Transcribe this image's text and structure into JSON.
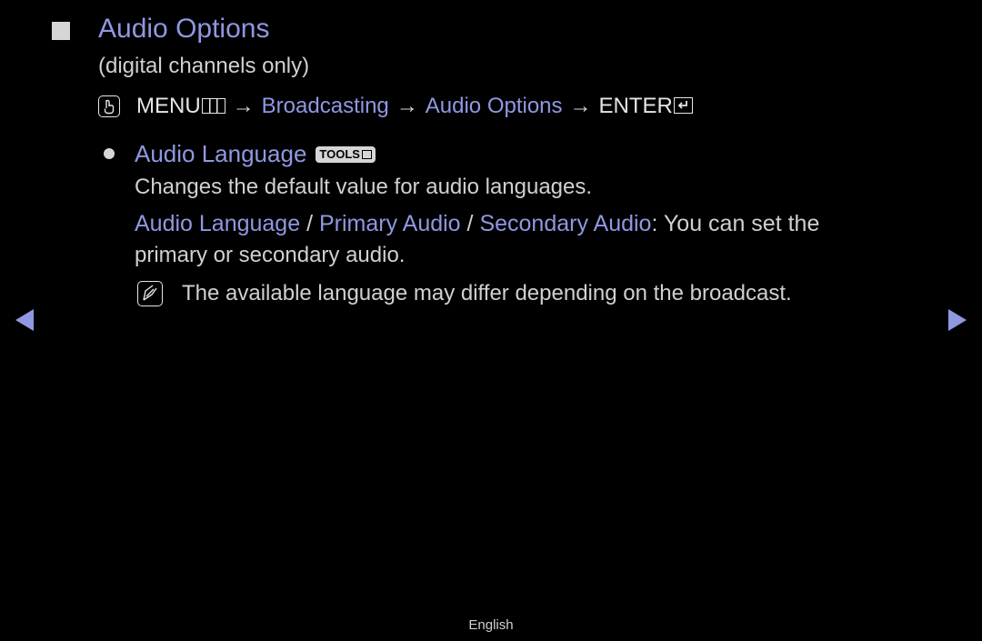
{
  "header": {
    "title": "Audio Options",
    "subtitle": "(digital channels only)"
  },
  "menu_path": {
    "icon": "hand-pointer-icon",
    "menu_label": "MENU",
    "arrow": "→",
    "steps": [
      "Broadcasting",
      "Audio Options"
    ],
    "enter_label": "ENTER"
  },
  "section": {
    "heading": "Audio Language",
    "tools_badge": "TOOLS",
    "description": "Changes the default value for audio languages.",
    "options": [
      "Audio Language",
      "Primary Audio",
      "Secondary Audio"
    ],
    "separator": " / ",
    "options_suffix": ": You can set the",
    "options_line2": "primary or secondary audio.",
    "note": "The available language may differ depending on the broadcast."
  },
  "navigation": {
    "prev": "previous-page",
    "next": "next-page"
  },
  "footer": {
    "language": "English"
  },
  "colors": {
    "accent": "#8f98e0",
    "text": "#d0d0d0",
    "background": "#000000"
  }
}
